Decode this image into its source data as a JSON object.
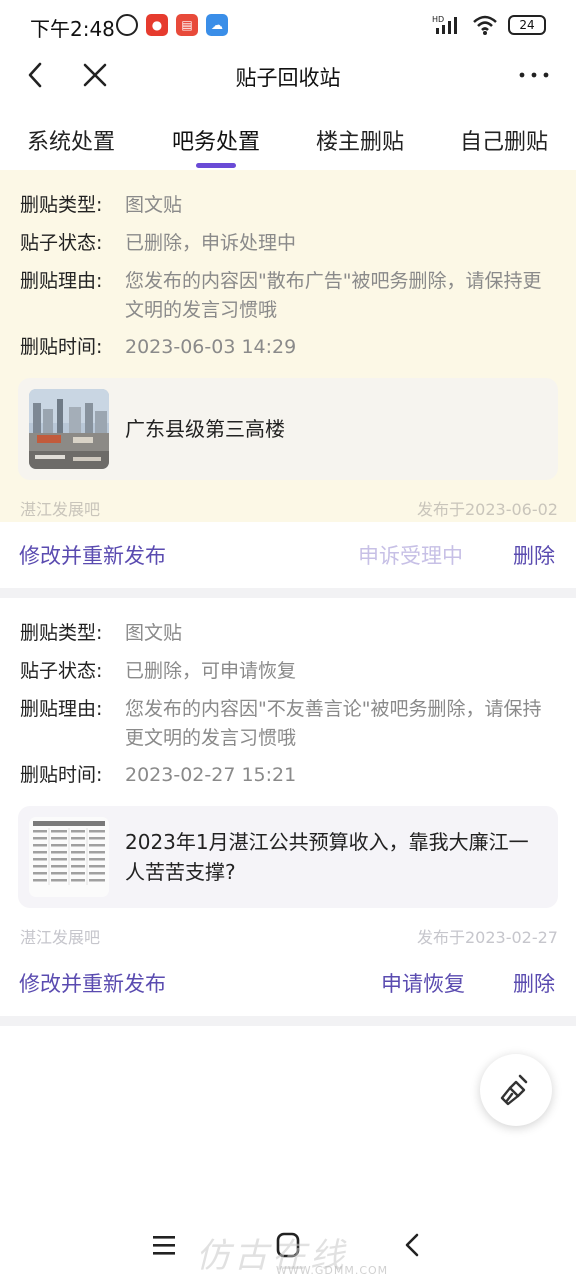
{
  "status_bar": {
    "time": "下午2:48",
    "battery": "24",
    "hd_label": "HD"
  },
  "nav": {
    "title": "贴子回收站",
    "back_icon": "chevron-left-icon",
    "close_icon": "close-icon",
    "more_icon": "more-dots-icon"
  },
  "tabs": [
    {
      "label": "系统处置"
    },
    {
      "label": "吧务处置"
    },
    {
      "label": "楼主删贴"
    },
    {
      "label": "自己删贴"
    }
  ],
  "active_tab": 1,
  "colors": {
    "accent": "#6a4bd6",
    "action_text": "#5a4bb0",
    "disabled_action": "#c7c0e6",
    "card_highlight": "#fcf8e6"
  },
  "labels": {
    "type": "删贴类型:",
    "status": "贴子状态:",
    "reason": "删贴理由:",
    "time": "删贴时间:"
  },
  "items": [
    {
      "type": "图文贴",
      "status": "已删除，申诉处理中",
      "reason": "您发布的内容因\"散布广告\"被吧务删除，请保持更文明的发言习惯哦",
      "time": "2023-06-03 14:29",
      "post_title": "广东县级第三高楼",
      "bar": "湛江发展吧",
      "published": "发布于2023-06-02",
      "actions": {
        "edit": "修改并重新发布",
        "middle": "申诉受理中",
        "delete": "删除"
      }
    },
    {
      "type": "图文贴",
      "status": "已删除，可申请恢复",
      "reason": "您发布的内容因\"不友善言论\"被吧务删除，请保持更文明的发言习惯哦",
      "time": "2023-02-27 15:21",
      "post_title": "2023年1月湛江公共预算收入，靠我大廉江一人苦苦支撑?",
      "bar": "湛江发展吧",
      "published": "发布于2023-02-27",
      "actions": {
        "edit": "修改并重新发布",
        "middle": "申请恢复",
        "delete": "删除"
      }
    }
  ],
  "fab_icon": "broom-icon",
  "watermark": {
    "text": "仿古在线",
    "url": "WWW.GDMM.COM"
  }
}
